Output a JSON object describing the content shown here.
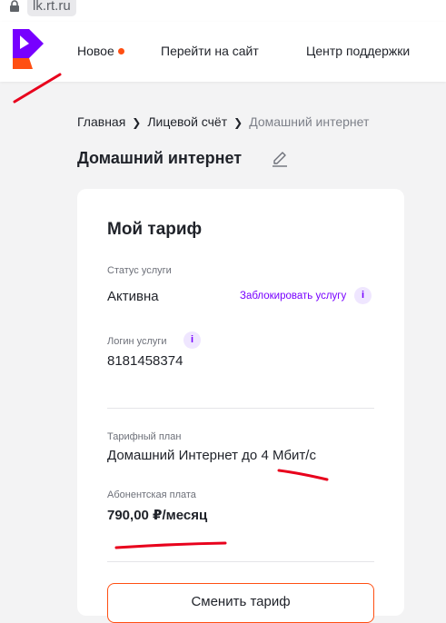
{
  "browser": {
    "url": "lk.rt.ru"
  },
  "header": {
    "nav": [
      {
        "label": "Новое",
        "has_dot": true
      },
      {
        "label": "Перейти на сайт"
      },
      {
        "label": "Центр поддержки"
      }
    ]
  },
  "breadcrumb": {
    "items": [
      "Главная",
      "Лицевой счёт",
      "Домашний интернет"
    ]
  },
  "page": {
    "title": "Домашний интернет"
  },
  "tariff_card": {
    "title": "Мой тариф",
    "status_label": "Статус услуги",
    "status_value": "Активна",
    "block_link": "Заблокировать услугу",
    "login_label": "Логин услуги",
    "login_value": "8181458374",
    "plan_label": "Тарифный план",
    "plan_value": "Домашний Интернет до 4 Мбит/с",
    "fee_label": "Абонентская плата",
    "fee_value": "790,00 ₽/месяц",
    "change_button": "Сменить тариф"
  },
  "colors": {
    "brand_orange": "#ff4f12",
    "brand_purple": "#7700ff",
    "annotation_red": "#e8001c"
  }
}
